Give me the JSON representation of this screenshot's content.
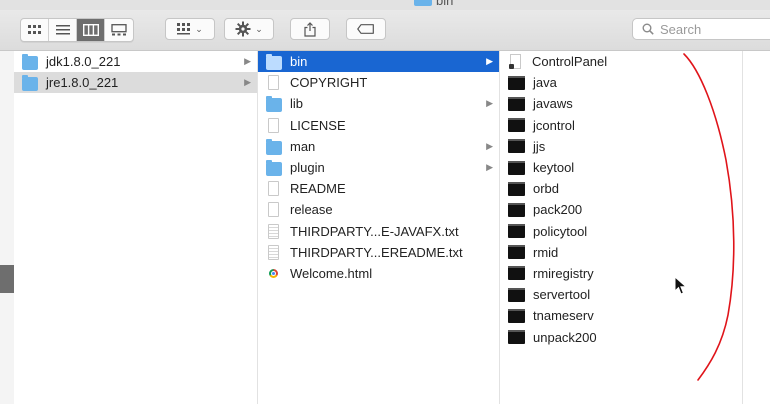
{
  "window": {
    "title": "bin"
  },
  "toolbar": {
    "view_buttons": [
      "icon-view",
      "list-view",
      "column-view",
      "gallery-view"
    ],
    "search": {
      "placeholder": "Search",
      "value": ""
    }
  },
  "columns": {
    "col1": [
      {
        "name": "jdk1.8.0_221",
        "kind": "folder",
        "has_children": true
      },
      {
        "name": "jre1.8.0_221",
        "kind": "folder",
        "has_children": true,
        "selected": true
      }
    ],
    "col2": [
      {
        "name": "bin",
        "kind": "folder",
        "has_children": true,
        "selected": true
      },
      {
        "name": "COPYRIGHT",
        "kind": "doc"
      },
      {
        "name": "lib",
        "kind": "folder",
        "has_children": true
      },
      {
        "name": "LICENSE",
        "kind": "doc"
      },
      {
        "name": "man",
        "kind": "folder",
        "has_children": true
      },
      {
        "name": "plugin",
        "kind": "folder",
        "has_children": true
      },
      {
        "name": "README",
        "kind": "doc"
      },
      {
        "name": "release",
        "kind": "doc"
      },
      {
        "name": "THIRDPARTY...E-JAVAFX.txt",
        "kind": "text"
      },
      {
        "name": "THIRDPARTY...EREADME.txt",
        "kind": "text"
      },
      {
        "name": "Welcome.html",
        "kind": "html"
      }
    ],
    "col3": [
      {
        "name": "ControlPanel",
        "kind": "applet"
      },
      {
        "name": "java",
        "kind": "exec"
      },
      {
        "name": "javaws",
        "kind": "exec"
      },
      {
        "name": "jcontrol",
        "kind": "exec"
      },
      {
        "name": "jjs",
        "kind": "exec"
      },
      {
        "name": "keytool",
        "kind": "exec"
      },
      {
        "name": "orbd",
        "kind": "exec"
      },
      {
        "name": "pack200",
        "kind": "exec"
      },
      {
        "name": "policytool",
        "kind": "exec"
      },
      {
        "name": "rmid",
        "kind": "exec"
      },
      {
        "name": "rmiregistry",
        "kind": "exec"
      },
      {
        "name": "servertool",
        "kind": "exec"
      },
      {
        "name": "tnameserv",
        "kind": "exec"
      },
      {
        "name": "unpack200",
        "kind": "exec"
      }
    ]
  },
  "colors": {
    "selection_blue": "#1966d2",
    "selection_gray": "#dcdcdc",
    "folder_blue": "#6ab3ea",
    "annotation_red": "#e0141a"
  }
}
